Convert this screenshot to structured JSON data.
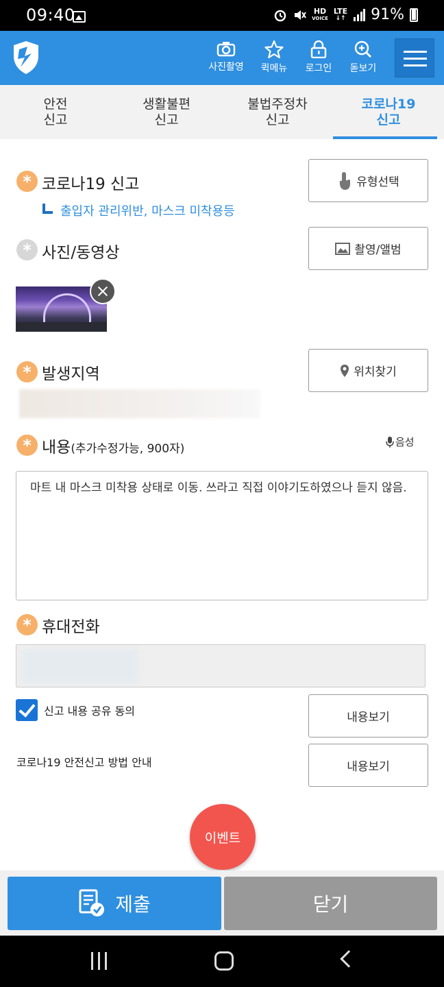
{
  "status_bar": {
    "time": "09:40",
    "network_hd": "HD",
    "network_lte": "LTE",
    "battery": "91%"
  },
  "header": {
    "buttons": [
      {
        "label": "사진촬영",
        "icon": "camera-icon"
      },
      {
        "label": "퀵메뉴",
        "icon": "star-icon"
      },
      {
        "label": "로그인",
        "icon": "lock-icon"
      },
      {
        "label": "돋보기",
        "icon": "zoom-in-icon"
      }
    ],
    "menu_icon": "hamburger-menu-icon"
  },
  "tabs": [
    {
      "label": "안전\n신고",
      "active": false
    },
    {
      "label": "생활불편\n신고",
      "active": false
    },
    {
      "label": "불법주정차\n신고",
      "active": false
    },
    {
      "label": "코로나19\n신고",
      "active": true
    }
  ],
  "form": {
    "type_label": "코로나19 신고",
    "type_sub": "출입자 관리위반, 마스크 미착용등",
    "type_button": "유형선택",
    "media_label": "사진/동영상",
    "media_button": "촬영/앨범",
    "location_label": "발생지역",
    "location_button": "위치찾기",
    "content_label": "내용",
    "content_hint": "(추가수정가능, 900자)",
    "voice_button": "음성",
    "content_value": "마트 내 마스크 미착용 상태로 이동. 쓰라고 직접 이야기도하였으나 듣지 않음.",
    "phone_label": "휴대전화",
    "consent_label": "신고 내용 공유 동의",
    "consent_checked": true,
    "consent_button": "내용보기",
    "guide_label": "코로나19 안전신고 방법 안내",
    "guide_button": "내용보기"
  },
  "event_button": "이벤트",
  "bottom": {
    "submit": "제출",
    "close": "닫기"
  },
  "colors": {
    "primary": "#2f8fe0",
    "required_star": "#f6b06a",
    "event": "#f2554e",
    "close_button": "#999999"
  }
}
